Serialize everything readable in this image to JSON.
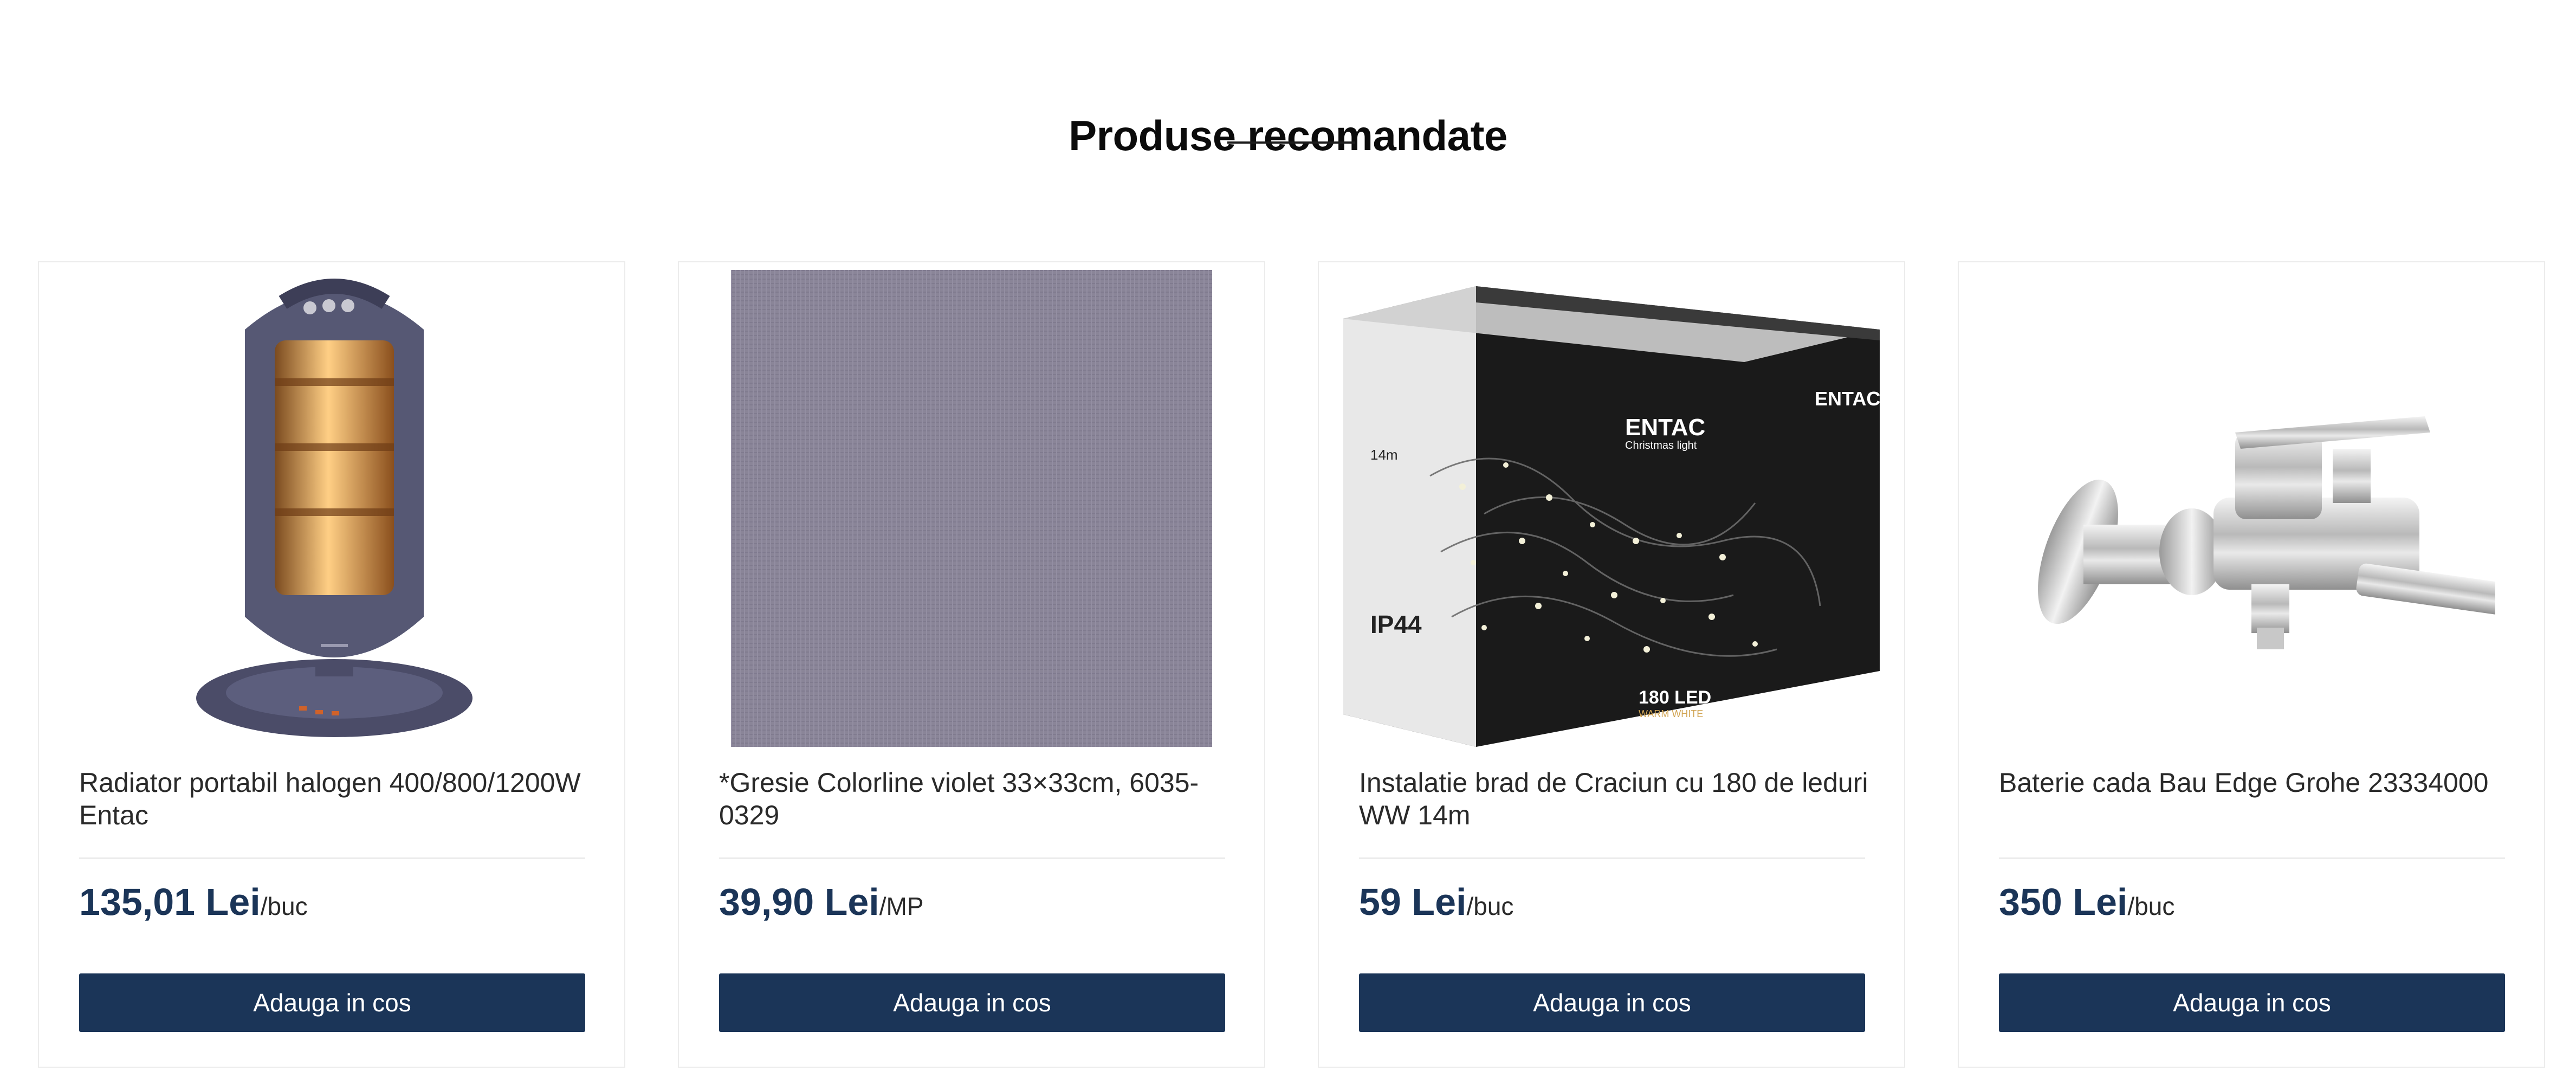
{
  "section": {
    "title": "Produse recomandate"
  },
  "colors": {
    "accent": "#1b3558",
    "card_border": "#ececec",
    "text": "#2a2a2a"
  },
  "products": [
    {
      "name": "Radiator portabil halogen 400/800/1200W Entac",
      "price": "135,01 Lei",
      "unit": "/buc",
      "button_label": "Adauga in cos",
      "image": "halogen-heater-image"
    },
    {
      "name": "*Gresie Colorline violet 33×33cm, 6035-0329",
      "price": "39,90 Lei",
      "unit": "/MP",
      "button_label": "Adauga in cos",
      "image": "violet-tile-image"
    },
    {
      "name": "Instalatie brad de Craciun cu 180 de leduri WW 14m",
      "price": "59 Lei",
      "unit": "/buc",
      "button_label": "Adauga in cos",
      "image": "christmas-lights-box-image",
      "image_text": {
        "brand": "ENTAC",
        "subtitle": "Christmas light",
        "rating": "IP44",
        "count": "180 LED",
        "color": "WARM WHITE",
        "length": "14m"
      }
    },
    {
      "name": "Baterie cada Bau Edge Grohe 23334000",
      "price": "350 Lei",
      "unit": "/buc",
      "button_label": "Adauga in cos",
      "image": "bath-faucet-image"
    }
  ]
}
